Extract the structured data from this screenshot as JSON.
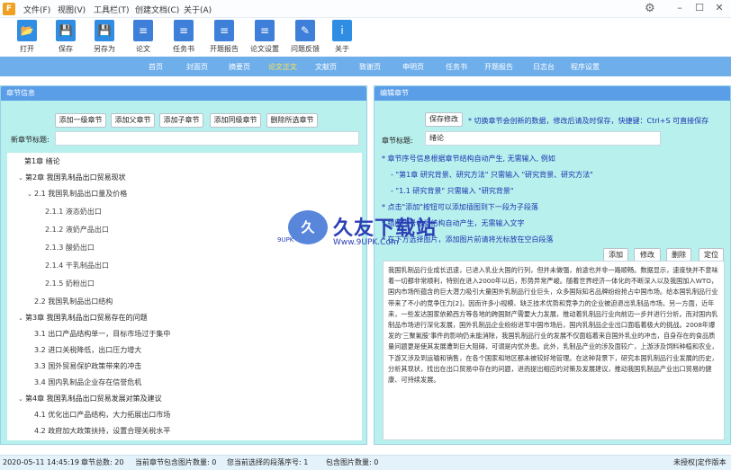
{
  "app": {
    "logo_glyph": "F"
  },
  "menu": {
    "items": [
      "文件(F)",
      "视图(V)",
      "工具栏(T)",
      "创建文档(C)",
      "关于(A)"
    ],
    "icons": [
      "settings-icon",
      "minimize-icon",
      "maximize-icon",
      "close-icon"
    ]
  },
  "toolbar": {
    "buttons": [
      "打开",
      "保存",
      "另存为",
      "论文",
      "任务书",
      "开题报告",
      "论文设置",
      "问题反馈",
      "关于"
    ]
  },
  "nav": {
    "tabs": [
      "首页",
      "封面页",
      "摘要页",
      "论文正文",
      "文献页",
      "致谢页",
      "申明页",
      "任务书",
      "开题报告",
      "日志台",
      "程序设置"
    ],
    "active": "论文正文"
  },
  "left": {
    "header": "章节信息",
    "buttons": [
      "添加一级章节",
      "添加父章节",
      "添加子章节",
      "添加同级章节",
      "删除所选章节"
    ],
    "title_label": "新章节标题:",
    "title_value": "",
    "tree": [
      "第1章  绪论",
      "第2章  我国乳制品出口贸易现状",
      "2.1 我国乳制品出口量及价格",
      "2.1.1 液态奶出口",
      "2.1.2 液奶产品出口",
      "2.1.3 酸奶出口",
      "2.1.4 干乳制品出口",
      "2.1.5 奶粉出口",
      "2.2 我国乳制品出口结构",
      "第3章  我国乳制品出口贸易存在的问题",
      "3.1 出口产品结构单一，目标市场过于集中",
      "3.2 进口关税降低，出口压力增大",
      "3.3 国外贸易保护政策带来的冲击",
      "3.4 国内乳制品企业存在信誉危机",
      "第4章  我国乳制品出口贸易发展对策及建议",
      "4.1 优化出口产品结构，大力拓展出口市场",
      "4.2 政府加大政策扶持，设置合理关税水平"
    ]
  },
  "right": {
    "header": "编辑章节",
    "save_button": "保存修改",
    "save_hint": "* 切换章节会创新的数据，修改后请及时保存，快捷键：Ctrl+S 可直接保存",
    "title_label": "章节标题:",
    "title_value": "绪论",
    "hints": [
      "* 章节序号信息根据章节结构自动产生, 无需输入, 例如",
      "- \"第1章 研究背景、研究方法\" 只需输入 \"研究背景、研究方法\"",
      "- \"1.1 研究背景\" 只需输入 \"研究背景\"",
      "* 点击\"添加\"按钮可以添加插图到下一段为子段落",
      "* 插图序号根据结构自动产生，无需输入文字",
      "* 在下方选择图片，添加图片前请将光标放在空白段落"
    ],
    "action_buttons": [
      "添加",
      "修改",
      "删除",
      "定位"
    ],
    "body_text": "我国乳制品行业成长迅速，已进入乳业大国的行列，但并未做强，前途也并非一路顺畅。数据显示，速度快并不意味着一切都非常顺利，特别在进入2000年以后，形势异常严峻。随着世界经济一体化的不断深入以及我国加入WTO，国内市场所蕴含的巨大潜力吸引大量国外乳制品行业巨头，众多国际知名品牌纷纷抢占中国市场。给本国乳制品行业带来了不小的竞争压力[2]，因而许多小规模、缺乏技术优势和竞争力的企业被迫退出乳制品市场。另一方面，近年来，一些发达国家依赖西方等各地的跨国财产需要大力发展，推动着乳制品行业向前迈一步并进行分析。而对国内乳制品市场进行深化发展，国外乳制品企业纷纷进军中国市场后，国内乳制品企业出口面临着极大的挑战。2008年爆发的'三聚氰胺'事件的影响仍未能消除，我国乳制品行业的发展不仅面临着来自国外乳业的冲击，自身存在的食品质量问题更是使其发展遭到巨大阻碍，可谓是内忧外患。此外，乳制品产业的涉及面较广，上游涉及饲料种植和农业，下游又涉及到运输和销售，在各个国家和地区都未被较好地管理。在这种背景下，研究本国乳制品行业发展的历史，分析其现状，找出在出口贸易中存在的问题，进而提出相应的对策及发展建议，推动我国乳制品产业出口贸易的健康、可持续发展。"
  },
  "watermark": {
    "logo_glyph": "久",
    "title": "久友下载站",
    "url": "Www.9UPK.Com",
    "site": "9UPK"
  },
  "status": {
    "datetime": "2020-05-11 14:45:19",
    "chapter_count": "章节总数: 20",
    "pic_count": "当前章节包含图片数量: 0",
    "para_index": "您当前选择的段落序号: 1",
    "para_pics": "包含图片数量: 0",
    "note": "未授权|定作版本"
  }
}
